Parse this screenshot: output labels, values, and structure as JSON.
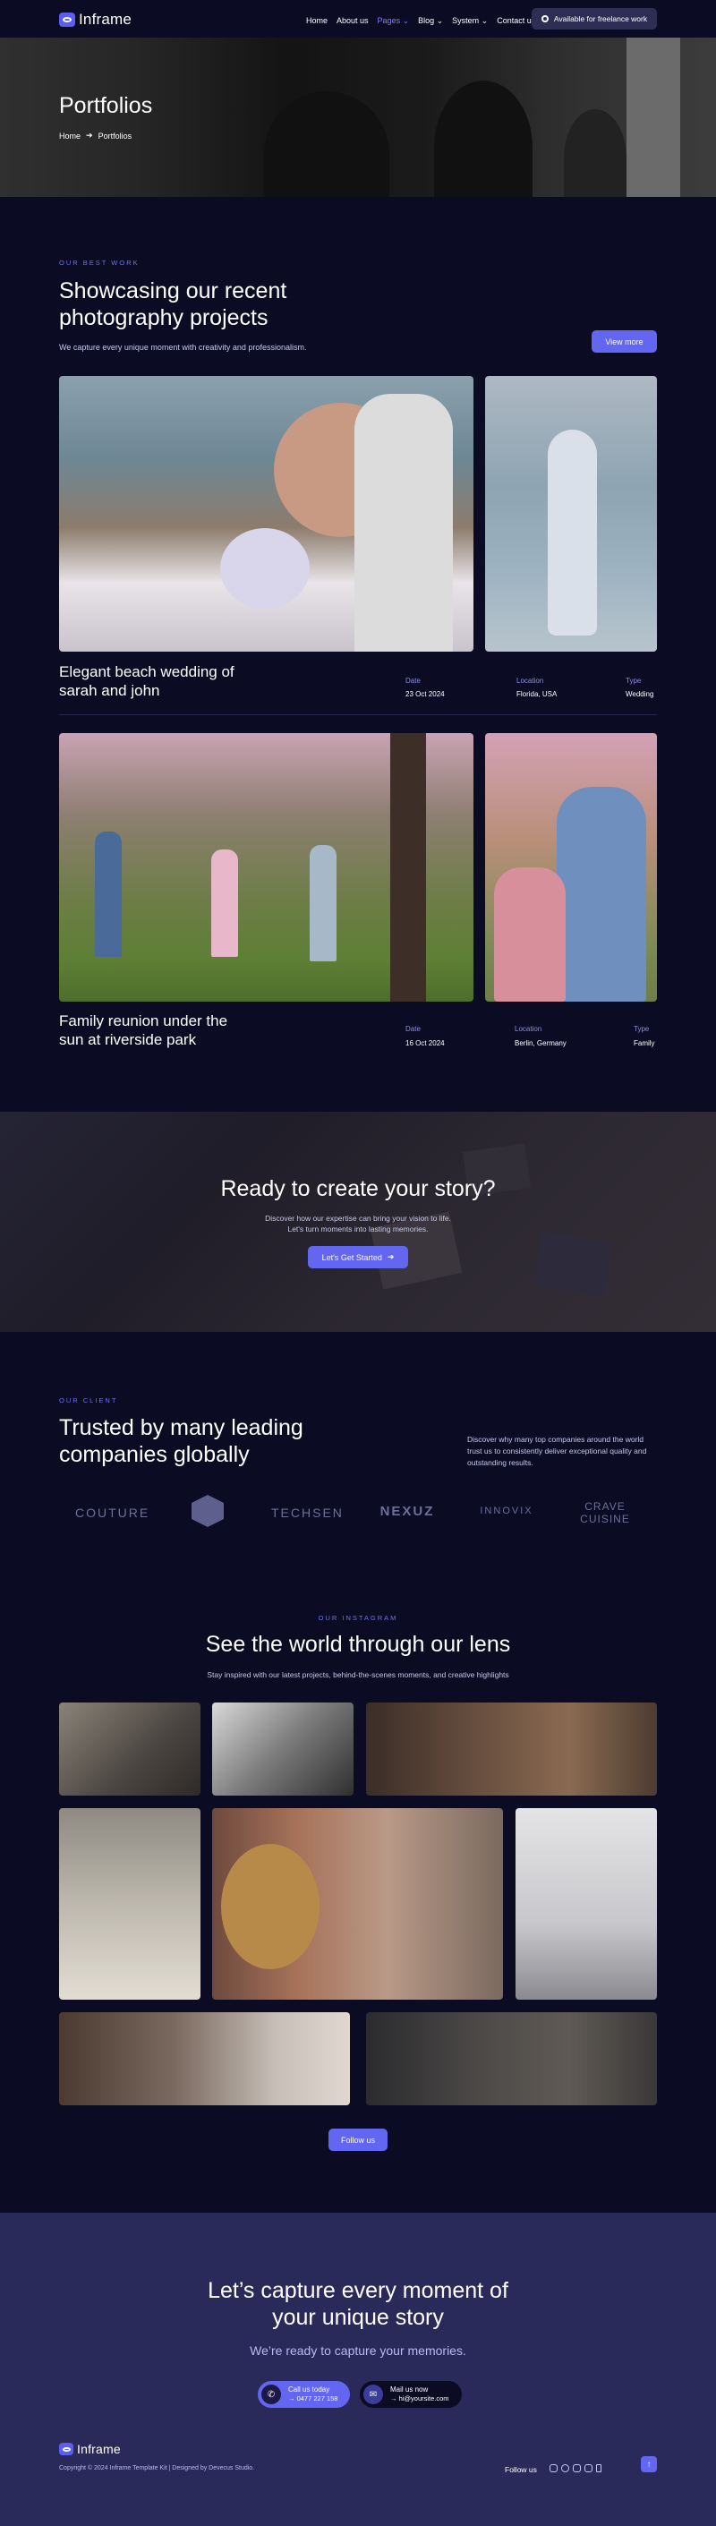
{
  "brand": {
    "name": "Inframe",
    "accent": "#6266f1",
    "bg": "#0b0b24"
  },
  "nav": {
    "items": [
      {
        "label": "Home"
      },
      {
        "label": "About us"
      },
      {
        "label": "Pages ⌄"
      },
      {
        "label": "Blog ⌄"
      },
      {
        "label": "System ⌄"
      },
      {
        "label": "Contact us"
      }
    ],
    "available_label": "Available for freelance work"
  },
  "hero": {
    "title": "Portfolios",
    "breadcrumb_home": "Home",
    "breadcrumb_current": "Portfolios"
  },
  "work": {
    "eyebrow": "OUR BEST WORK",
    "title_line1": "Showcasing our recent",
    "title_line2": "photography projects",
    "subtitle": "We capture every unique moment with creativity and professionalism.",
    "view_more": "View more",
    "projects": [
      {
        "title_line1": "Elegant beach wedding of",
        "title_line2": "sarah and john",
        "date_label": "Date",
        "date": "23 Oct 2024",
        "location_label": "Location",
        "location": "Florida, USA",
        "type_label": "Type",
        "type": "Wedding"
      },
      {
        "title_line1": "Family reunion under the",
        "title_line2": "sun at riverside park",
        "date_label": "Date",
        "date": "16 Oct 2024",
        "location_label": "Location",
        "location": "Berlin, Germany",
        "type_label": "Type",
        "type": "Family"
      }
    ]
  },
  "cta": {
    "title": "Ready to create your story?",
    "text_line1": "Discover how our expertise can bring your vision to life.",
    "text_line2": "Let's turn moments into lasting memories.",
    "button": "Let's Get Started"
  },
  "clients": {
    "eyebrow": "OUR CLIENT",
    "title_line1": "Trusted by many leading",
    "title_line2": "companies globally",
    "text": "Discover why many top companies around the world trust us to consistently deliver exceptional quality and outstanding results.",
    "logos": [
      "COUTURE",
      "",
      "TECHSEN",
      "NEXUZ",
      "INNOVIX",
      "CRAVE CUISINE"
    ]
  },
  "instagram": {
    "eyebrow": "OUR INSTAGRAM",
    "title": "See the world through our lens",
    "subtitle": "Stay inspired with our latest projects, behind-the-scenes moments, and creative highlights",
    "follow": "Follow us"
  },
  "footer": {
    "title_line1": "Let’s capture every moment of",
    "title_line2": "your unique story",
    "subtitle": "We’re ready to capture your memories.",
    "call_label": "Call us today",
    "call_value": "→ 0477 227 158",
    "mail_label": "Mail us now",
    "mail_value": "→ hi@yoursite.com",
    "brand": "Inframe",
    "copyright": "Copyright © 2024 Inframe Template Kit | Designed by Devecus Studio.",
    "follow_label": "Follow us"
  }
}
